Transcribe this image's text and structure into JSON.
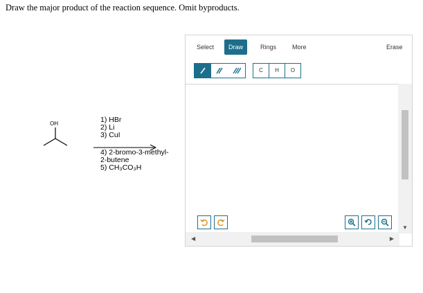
{
  "question": "Draw the major product of the reaction sequence. Omit byproducts.",
  "molecule": {
    "oh_label": "OH"
  },
  "reagents_above": [
    "1) HBr",
    "2) Li",
    "3) CuI"
  ],
  "reagents_below": [
    "4) 2-bromo-3-methyl-",
    "2-butene",
    "5) CH₃CO₃H"
  ],
  "editor": {
    "tabs": [
      {
        "label": "Select",
        "active": false
      },
      {
        "label": "Draw",
        "active": true
      },
      {
        "label": "Rings",
        "active": false
      },
      {
        "label": "More",
        "active": false
      },
      {
        "label": "Erase",
        "active": false
      }
    ],
    "bond_tools": [
      "single-bond",
      "double-bond",
      "triple-bond"
    ],
    "atoms": [
      "C",
      "H",
      "O"
    ],
    "icons": {
      "undo": "undo-icon",
      "redo": "redo-icon",
      "zoom_in": "zoom-in-icon",
      "reset": "reset-view-icon",
      "zoom_out": "zoom-out-icon"
    },
    "accent_color": "#1d6e8b"
  }
}
